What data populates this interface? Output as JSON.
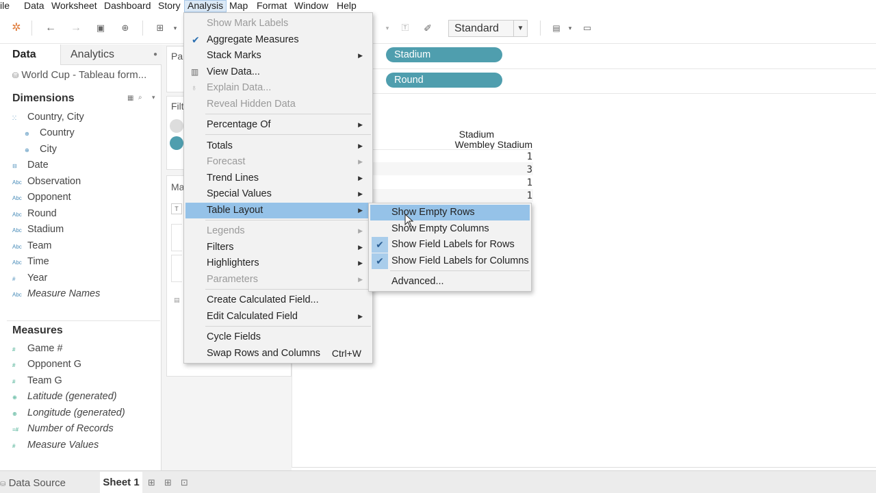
{
  "menubar": {
    "items": [
      "ile",
      "Data",
      "Worksheet",
      "Dashboard",
      "Story",
      "Analysis",
      "Map",
      "Format",
      "Window",
      "Help"
    ],
    "active": "Analysis"
  },
  "toolbar": {
    "fit_value": "Standard"
  },
  "datapane": {
    "tab_data": "Data",
    "tab_analytics": "Analytics",
    "datasource": "World Cup - Tableau form...",
    "dimensions_title": "Dimensions",
    "dimensions": [
      {
        "label": "Country, City",
        "icon": "hierarchy-icon",
        "indent": false
      },
      {
        "label": "Country",
        "icon": "globe-icon",
        "indent": true
      },
      {
        "label": "City",
        "icon": "globe-icon",
        "indent": true
      },
      {
        "label": "Date",
        "icon": "calendar-icon",
        "indent": false
      },
      {
        "label": "Observation",
        "icon": "abc-icon",
        "indent": false
      },
      {
        "label": "Opponent",
        "icon": "abc-icon",
        "indent": false
      },
      {
        "label": "Round",
        "icon": "abc-icon",
        "indent": false
      },
      {
        "label": "Stadium",
        "icon": "abc-icon",
        "indent": false
      },
      {
        "label": "Team",
        "icon": "abc-icon",
        "indent": false
      },
      {
        "label": "Time",
        "icon": "abc-icon",
        "indent": false
      },
      {
        "label": "Year",
        "icon": "number-icon",
        "indent": false
      },
      {
        "label": "Measure Names",
        "icon": "abc-icon",
        "indent": false
      }
    ],
    "measures_title": "Measures",
    "measures": [
      {
        "label": "Game #",
        "icon": "number-icon"
      },
      {
        "label": "Opponent G",
        "icon": "number-icon"
      },
      {
        "label": "Team G",
        "icon": "number-icon"
      },
      {
        "label": "Latitude (generated)",
        "icon": "globe-icon"
      },
      {
        "label": "Longitude (generated)",
        "icon": "globe-icon"
      },
      {
        "label": "Number of Records",
        "icon": "number-icon"
      },
      {
        "label": "Measure Values",
        "icon": "number-icon"
      }
    ]
  },
  "shelves": {
    "pages_label": "Pa",
    "filters_label": "Filt",
    "marks_label": "Ma",
    "columns_pill": "Stadium",
    "rows_pill": "Round"
  },
  "view": {
    "header_field": "Stadium",
    "header_value": "Wembley Stadium",
    "values": [
      "1",
      "3",
      "1",
      "1"
    ]
  },
  "analysis_menu": {
    "items": [
      {
        "label": "Show Mark Labels",
        "disabled": true
      },
      {
        "label": "Aggregate Measures",
        "checked": true
      },
      {
        "label": "Stack Marks",
        "submenu": true
      },
      {
        "label": "View Data...",
        "icon": "table-icon"
      },
      {
        "label": "Explain Data...",
        "disabled": true,
        "icon": "bulb-icon"
      },
      {
        "label": "Reveal Hidden Data",
        "disabled": true
      },
      {
        "label": "Percentage Of",
        "submenu": true
      },
      {
        "label": "Totals",
        "submenu": true
      },
      {
        "label": "Forecast",
        "submenu": true,
        "disabled": true
      },
      {
        "label": "Trend Lines",
        "submenu": true
      },
      {
        "label": "Special Values",
        "submenu": true
      },
      {
        "label": "Table Layout",
        "submenu": true,
        "highlighted": true
      },
      {
        "label": "Legends",
        "submenu": true,
        "disabled": true
      },
      {
        "label": "Filters",
        "submenu": true
      },
      {
        "label": "Highlighters",
        "submenu": true
      },
      {
        "label": "Parameters",
        "submenu": true,
        "disabled": true
      },
      {
        "label": "Create Calculated Field..."
      },
      {
        "label": "Edit Calculated Field",
        "submenu": true
      },
      {
        "label": "Cycle Fields"
      },
      {
        "label": "Swap Rows and Columns",
        "shortcut": "Ctrl+W"
      }
    ]
  },
  "table_layout_menu": {
    "items": [
      {
        "label": "Show Empty Rows",
        "highlighted": true
      },
      {
        "label": "Show Empty Columns"
      },
      {
        "label": "Show Field Labels for Rows",
        "checked": true
      },
      {
        "label": "Show Field Labels for Columns",
        "checked": true
      },
      {
        "label": "Advanced..."
      }
    ]
  },
  "bottombar": {
    "datasource_tab": "Data Source",
    "sheet_tab": "Sheet 1"
  },
  "colors": {
    "pill": "#4f9eae",
    "menu_highlight": "#95c2e8",
    "menubar_active": "#dbe9f6"
  }
}
